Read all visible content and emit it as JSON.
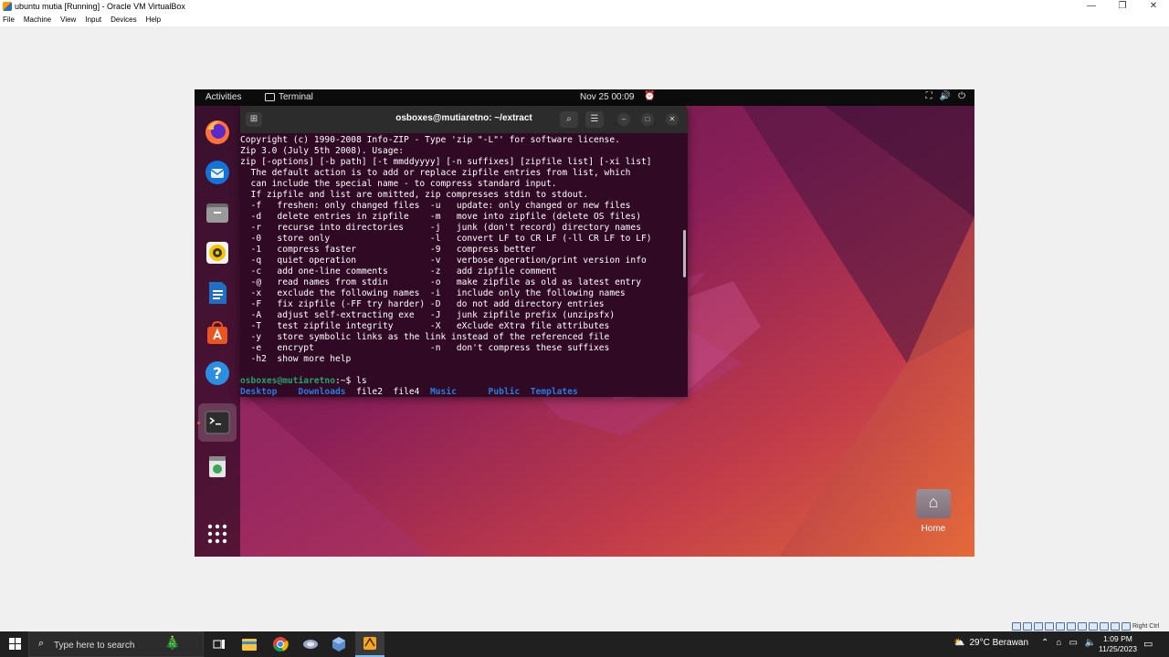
{
  "host_window": {
    "title": "ubuntu mutia [Running] - Oracle VM VirtualBox",
    "controls": [
      "—",
      "❐",
      "✕"
    ],
    "menu": [
      "File",
      "Machine",
      "View",
      "Input",
      "Devices",
      "Help"
    ],
    "status_label": "Right Ctrl"
  },
  "guest_topbar": {
    "activities": "Activities",
    "app_name": "Terminal",
    "clock": "Nov 25  00:09"
  },
  "dock": {
    "items": [
      "firefox-icon",
      "thunderbird-icon",
      "files-icon",
      "rhythmbox-icon",
      "writer-icon",
      "app-center-icon",
      "help-icon",
      "terminal-icon",
      "trash-icon",
      "show-apps-icon"
    ]
  },
  "terminal": {
    "title": "osboxes@mutiaretno: ~/extract",
    "lines": [
      "Copyright (c) 1990-2008 Info-ZIP - Type 'zip \"-L\"' for software license.",
      "Zip 3.0 (July 5th 2008). Usage:",
      "zip [-options] [-b path] [-t mmddyyyy] [-n suffixes] [zipfile list] [-xi list]",
      "  The default action is to add or replace zipfile entries from list, which",
      "  can include the special name - to compress standard input.",
      "  If zipfile and list are omitted, zip compresses stdin to stdout.",
      "  -f   freshen: only changed files  -u   update: only changed or new files",
      "  -d   delete entries in zipfile    -m   move into zipfile (delete OS files)",
      "  -r   recurse into directories     -j   junk (don't record) directory names",
      "  -0   store only                   -l   convert LF to CR LF (-ll CR LF to LF)",
      "  -1   compress faster              -9   compress better",
      "  -q   quiet operation              -v   verbose operation/print version info",
      "  -c   add one-line comments        -z   add zipfile comment",
      "  -@   read names from stdin        -o   make zipfile as old as latest entry",
      "  -x   exclude the following names  -i   include only the following names",
      "  -F   fix zipfile (-FF try harder) -D   do not add directory entries",
      "  -A   adjust self-extracting exe   -J   junk zipfile prefix (unzipsfx)",
      "  -T   test zipfile integrity       -X   eXclude eXtra file attributes",
      "  -y   store symbolic links as the link instead of the referenced file",
      "  -e   encrypt                      -n   don't compress these suffixes",
      "  -h2  show more help",
      ""
    ],
    "prompt_user": "osboxes@mutiaretno",
    "prompt_path": ":~",
    "prompt_symbol": "$ ",
    "command": "ls",
    "ls_entries": [
      {
        "name": "Desktop",
        "type": "dir",
        "pad": "    "
      },
      {
        "name": "Downloads",
        "type": "dir",
        "pad": "  "
      },
      {
        "name": "file2",
        "type": "file",
        "pad": "  "
      },
      {
        "name": "file4",
        "type": "file",
        "pad": "  "
      },
      {
        "name": "Music",
        "type": "dir",
        "pad": "      "
      },
      {
        "name": "Public",
        "type": "dir",
        "pad": "  "
      },
      {
        "name": "Templates",
        "type": "dir",
        "pad": ""
      }
    ]
  },
  "desktop": {
    "home_label": "Home"
  },
  "taskbar": {
    "search_placeholder": "Type here to search",
    "weather": "29°C  Berawan",
    "time": "1:09 PM",
    "date": "11/25/2023"
  },
  "colors": {
    "terminal_bg": "#300a24",
    "prompt_green": "#26a269",
    "dir_blue": "#2a7bde",
    "ubuntu_orange": "#e95420"
  }
}
